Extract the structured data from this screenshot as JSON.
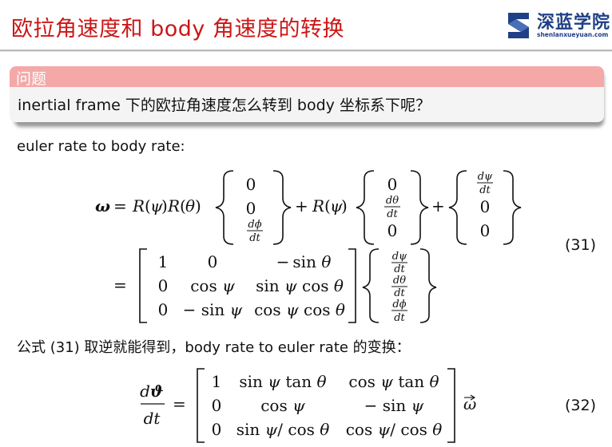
{
  "slide": {
    "title": "欧拉角速度和 body 角速度的转换"
  },
  "logo": {
    "name": "深蓝学院",
    "subtitle": "shenlanxueyuan.com",
    "brand_color": "#1f3f86"
  },
  "question_box": {
    "label": "问题",
    "text": "inertial frame 下的欧拉角速度怎么转到 body 坐标系下呢？",
    "header_color": "#f5a8a8"
  },
  "body": {
    "intro": "euler rate to body rate:",
    "transition": "公式 (31) 取逆就能得到，body rate to euler rate 的变换："
  },
  "equations": {
    "eq31_number": "(31)",
    "eq32_number": "(32)"
  },
  "colors": {
    "title": "#cc1616",
    "text": "#111111"
  }
}
